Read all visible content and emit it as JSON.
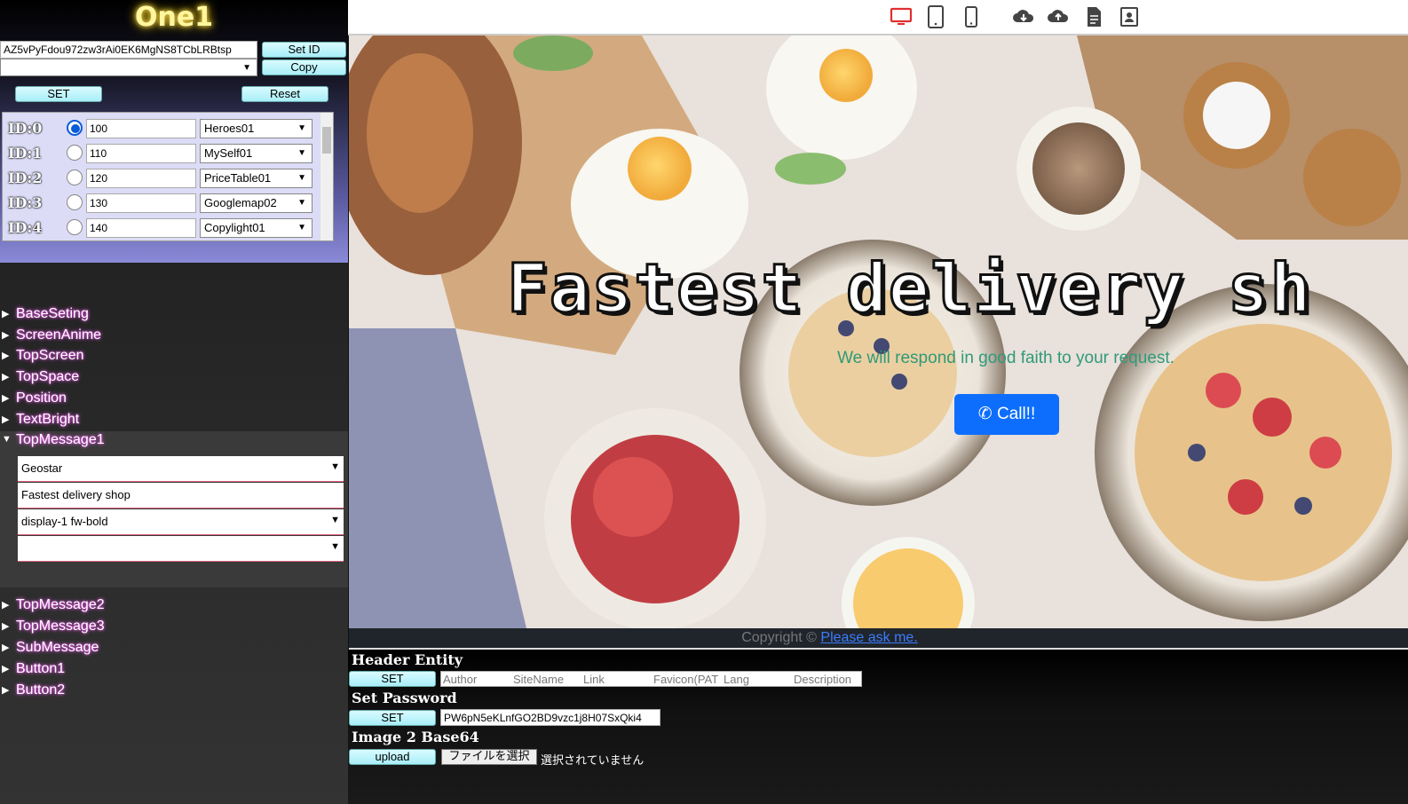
{
  "app": {
    "title": "One1"
  },
  "top": {
    "id_value": "AZ5vPyFdou972zw3rAi0EK6MgNS8TCbLRBtsp",
    "set_id": "Set ID",
    "copy": "Copy",
    "set": "SET",
    "reset": "Reset"
  },
  "ids": [
    {
      "label": "ID:0",
      "value": "100",
      "template": "Heroes01",
      "selected": true
    },
    {
      "label": "ID:1",
      "value": "110",
      "template": "MySelf01",
      "selected": false
    },
    {
      "label": "ID:2",
      "value": "120",
      "template": "PriceTable01",
      "selected": false
    },
    {
      "label": "ID:3",
      "value": "130",
      "template": "Googlemap02",
      "selected": false
    },
    {
      "label": "ID:4",
      "value": "140",
      "template": "Copylight01",
      "selected": false
    }
  ],
  "tree": {
    "items_top": [
      "BaseSeting",
      "ScreenAnime",
      "TopScreen",
      "TopSpace",
      "Position",
      "TextBright"
    ],
    "open_item": "TopMessage1",
    "open_fields": {
      "font": "Geostar",
      "text": "Fastest delivery shop",
      "style": "display-1 fw-bold",
      "extra": ""
    },
    "items_bottom": [
      "TopMessage2",
      "TopMessage3",
      "SubMessage",
      "Button1",
      "Button2"
    ]
  },
  "toolbar": {
    "icons": [
      "desktop-icon",
      "tablet-icon",
      "mobile-icon",
      "cloud-download-icon",
      "cloud-upload-icon",
      "document-icon",
      "contact-icon"
    ]
  },
  "preview": {
    "hero_title": "Fastest delivery sh",
    "hero_subtitle": "We will respond in good faith to your request.",
    "call_button": "Call!!",
    "footer_text": "Copyright ©",
    "footer_link": "Please ask me."
  },
  "bottom": {
    "header_entity": "Header Entity",
    "header_set": "SET",
    "header_fields": [
      "Author",
      "SiteName",
      "Link",
      "Favicon(PAT",
      "Lang",
      "Description"
    ],
    "set_password": "Set Password",
    "password_set": "SET",
    "password_value": "PW6pN5eKLnfGO2BD9vzc1j8H07SxQki4",
    "image_base64": "Image 2 Base64",
    "upload": "upload",
    "choose_file": "ファイルを選択",
    "no_file": "選択されていません"
  },
  "colors": {
    "accent_blue": "#0d6efd",
    "cyan_button": "#a8eef8",
    "title_glow": "#ffe35a",
    "subtitle_green": "#2f9a7a",
    "active_tool": "#e03030"
  }
}
